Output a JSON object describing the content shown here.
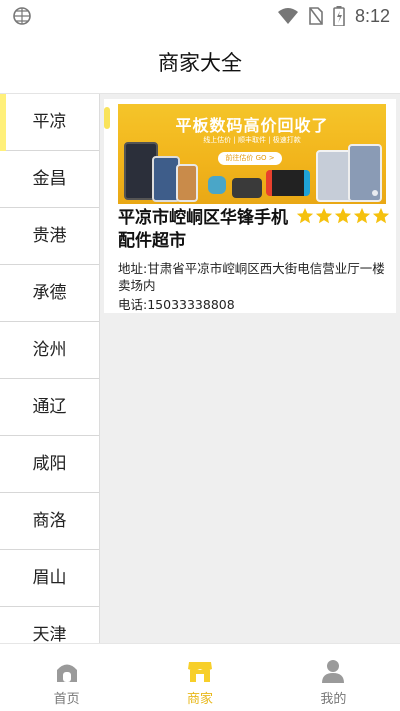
{
  "status_bar": {
    "time": "8:12",
    "icons": [
      "globe-icon",
      "wifi-icon",
      "no-sim-icon",
      "battery-icon"
    ]
  },
  "header": {
    "title": "商家大全"
  },
  "sidebar": {
    "active_index": 0,
    "accent_color": "#fff07a",
    "items": [
      {
        "label": "平凉"
      },
      {
        "label": "金昌"
      },
      {
        "label": "贵港"
      },
      {
        "label": "承德"
      },
      {
        "label": "沧州"
      },
      {
        "label": "通辽"
      },
      {
        "label": "咸阳"
      },
      {
        "label": "商洛"
      },
      {
        "label": "眉山"
      },
      {
        "label": "天津"
      }
    ]
  },
  "merchant": {
    "banner": {
      "title": "平板数码高价回收了",
      "subtitle": "线上估价 | 顺丰取件 | 极速打款",
      "button": "前往估价 GO >"
    },
    "name": "平凉市崆峒区华锋手机配件超市",
    "rating": 5,
    "rating_color": "#f5c10e",
    "address": "地址:甘肃省平凉市崆峒区西大街电信营业厅一楼卖场内",
    "phone": "电话:15033338808"
  },
  "tabbar": {
    "active_index": 1,
    "active_color": "#e8b81a",
    "tabs": [
      {
        "label": "首页",
        "icon": "home-icon"
      },
      {
        "label": "商家",
        "icon": "shop-icon"
      },
      {
        "label": "我的",
        "icon": "user-icon"
      }
    ]
  }
}
